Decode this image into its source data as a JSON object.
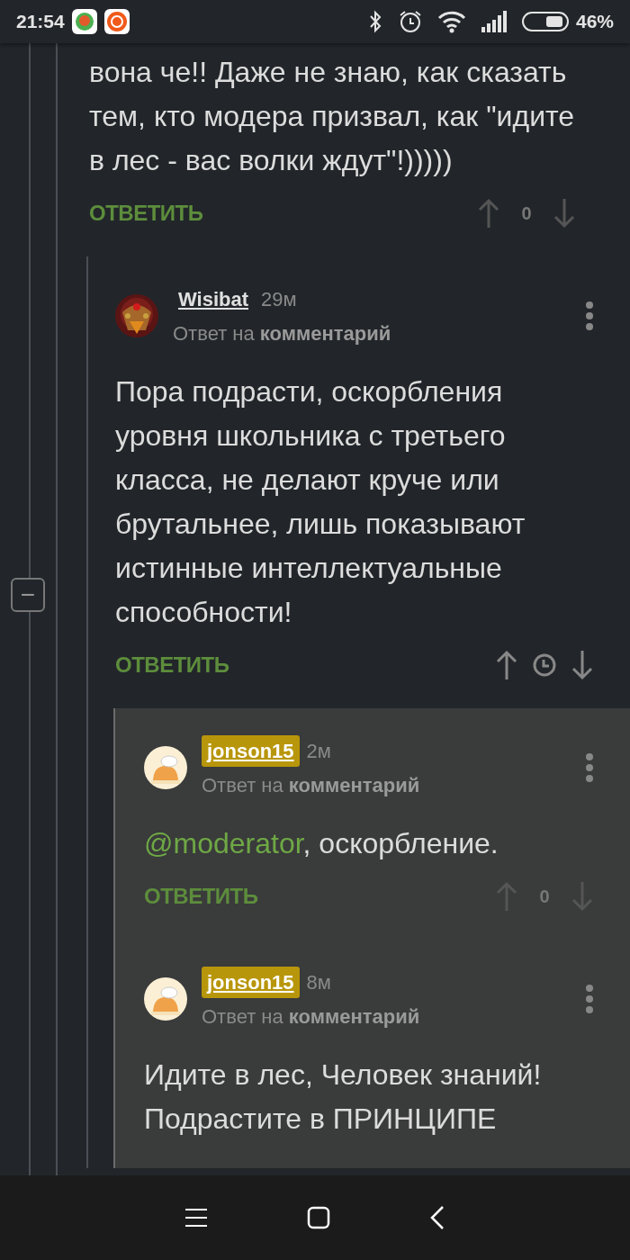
{
  "status_bar": {
    "time": "21:54",
    "battery": "46%"
  },
  "thread": [
    {
      "kind": "tail",
      "highlighted": false,
      "body": [
        {
          "kind": "text",
          "text": "вона че!! Даже не знаю, как сказать тем, кто модера призвал, как \"идите в лес - вас волки ждут\"!)))))"
        }
      ],
      "reply": "ОТВЕТИТЬ",
      "rating": {
        "kind": "score",
        "text": "0"
      }
    },
    {
      "kind": "comment",
      "highlighted": false,
      "author": {
        "name": "Wisibat",
        "badge": false
      },
      "time": "29м",
      "reply_to": "Ответ на **комментарий**",
      "body": [
        {
          "kind": "text",
          "text": "Пора подрасти, оскорбления уровня школьника с третьего класса, не делают круче или брутальнее, лишь показывают истинные интеллектуальные способности!"
        }
      ],
      "reply": "ОТВЕТИТЬ",
      "rating": {
        "kind": "pending"
      },
      "collapse": "−"
    },
    {
      "kind": "comment",
      "highlighted": true,
      "author": {
        "name": "jonson15",
        "badge": true,
        "avatar": {
          "kind": "drawing"
        }
      },
      "time": "2м",
      "reply_to": "Ответ на **комментарий**",
      "body": [
        {
          "kind": "mention",
          "text": "@moderator"
        },
        {
          "kind": "text",
          "text": ", оскорбление."
        }
      ],
      "reply": "ОТВЕТИТЬ",
      "rating": {
        "kind": "score",
        "text": "0"
      }
    },
    {
      "kind": "comment",
      "highlighted": true,
      "author": {
        "name": "jonson15",
        "badge": true,
        "avatar": {
          "kind": "drawing"
        }
      },
      "time": "8м",
      "reply_to": "Ответ на **комментарий**",
      "body": [
        {
          "kind": "text",
          "text": "Идите в лес, Человек знаний! Подрастите в ПРИНЦИПЕ"
        }
      ]
    }
  ]
}
